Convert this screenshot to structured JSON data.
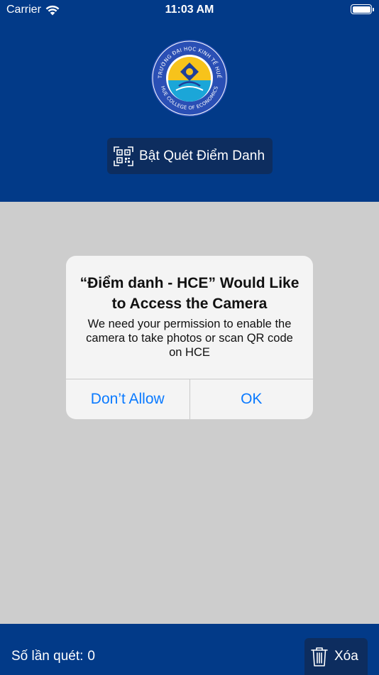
{
  "status_bar": {
    "carrier": "Carrier",
    "time": "11:03 AM",
    "wifi_icon": "wifi-icon",
    "battery_icon": "battery-full-icon"
  },
  "header": {
    "logo_icon": "hce-logo",
    "logo_text_top": "TRƯỜNG ĐẠI HỌC KINH TẾ HUẾ",
    "logo_text_bottom": "HUE COLLEGE OF ECONOMICS",
    "scan_button": {
      "icon": "qr-scan-icon",
      "label": "Bật Quét Điểm Danh"
    }
  },
  "dialog": {
    "title": "“Điểm danh - HCE” Would Like to Access the Camera",
    "message": "We need your permission to enable the camera to take photos or scan QR code on HCE",
    "buttons": [
      "Don’t Allow",
      "OK"
    ]
  },
  "footer": {
    "scan_count_label": "Số lần quét:",
    "scan_count_value": "0",
    "delete_button": {
      "icon": "trash-icon",
      "label": "Xóa"
    }
  },
  "colors": {
    "primary": "#023a88",
    "button_dark": "#0d2d5f",
    "overlay_gray": "#cdcdcd",
    "dialog_bg": "#f4f4f4",
    "ios_blue": "#0a7aff"
  }
}
